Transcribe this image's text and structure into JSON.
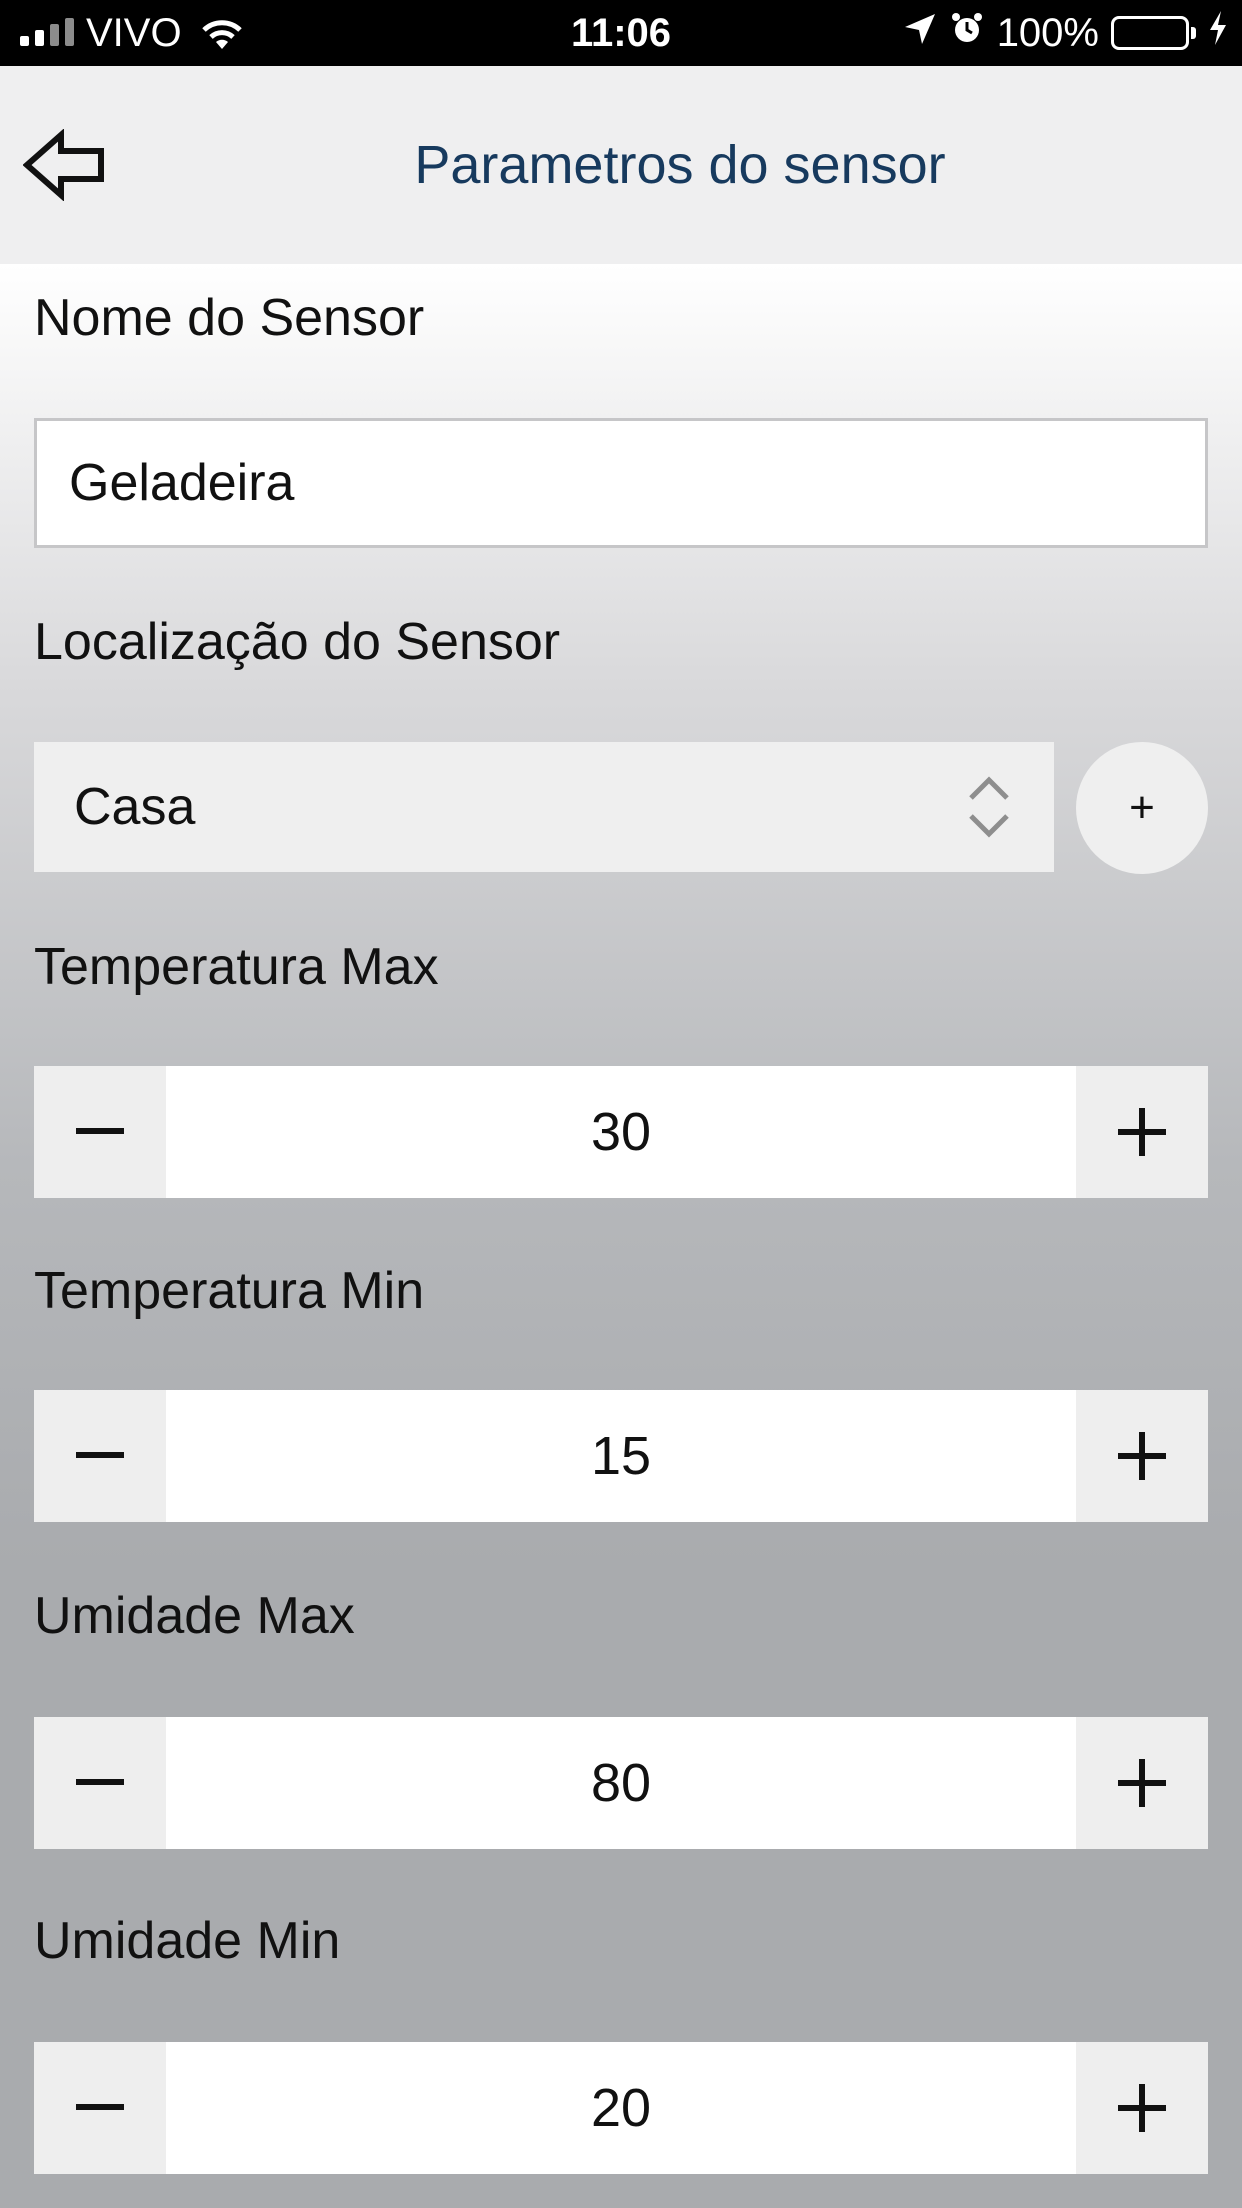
{
  "status_bar": {
    "carrier": "VIVO",
    "time": "11:06",
    "battery": "100%",
    "icons": [
      "signal-icon",
      "wifi-icon",
      "location-arrow-icon",
      "alarm-icon",
      "battery-icon",
      "charging-bolt-icon"
    ]
  },
  "nav": {
    "title": "Parametros do sensor",
    "back_icon": "back-arrow-icon"
  },
  "form": {
    "sensor_name": {
      "label": "Nome do Sensor",
      "value": "Geladeira"
    },
    "location": {
      "label": "Localização do Sensor",
      "selected": "Casa",
      "add_label": "+"
    },
    "temp_max": {
      "label": "Temperatura Max",
      "value": "30",
      "minus": "−",
      "plus": "+"
    },
    "temp_min": {
      "label": "Temperatura Min",
      "value": "15",
      "minus": "−",
      "plus": "+"
    },
    "hum_max": {
      "label": "Umidade Max",
      "value": "80",
      "minus": "−",
      "plus": "+"
    },
    "hum_min": {
      "label": "Umidade Min",
      "value": "20",
      "minus": "−",
      "plus": "+"
    }
  },
  "colors": {
    "title": "#173a5e",
    "nav_bg": "#efeff0",
    "battery": "#4cd964"
  }
}
